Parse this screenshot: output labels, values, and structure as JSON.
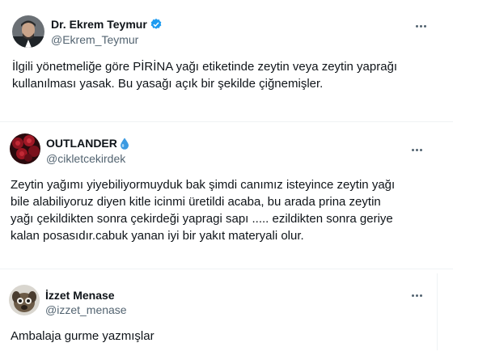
{
  "tweets": [
    {
      "name": "Dr. Ekrem Teymur",
      "handle": "@Ekrem_Teymur",
      "verified": true,
      "text_lines": [
        "İlgili yönetmeliğe göre PİRİNA yağı etiketinde zeytin veya zeytin yaprağı",
        "kullanılması yasak. Bu yasağı açık bir şekilde çiğnemişler."
      ]
    },
    {
      "name": "OUTLANDER",
      "handle": "@cikletcekirdek",
      "name_emoji": "droplet-icon",
      "text_lines": [
        "Zeytin yağımı yiyebiliyormuyduk bak şimdi canımız isteyince zeytin yağı",
        "bile alabiliyoruz diyen kitle icinmi üretildi acaba, bu arada prina zeytin",
        "yağı çekildikten sonra çekirdeği yapragi sapı ..... ezildikten sonra geriye",
        "kalan posasıdır.cabuk yanan iyi bir yakıt materyali olur."
      ]
    },
    {
      "name": "İzzet Menase",
      "handle": "@izzet_menase",
      "text_lines": [
        "Ambalaja gurme yazmışlar"
      ]
    }
  ],
  "colors": {
    "verified": "#1d9bf0",
    "secondary_text": "#536471",
    "divider": "#eff3f4"
  }
}
